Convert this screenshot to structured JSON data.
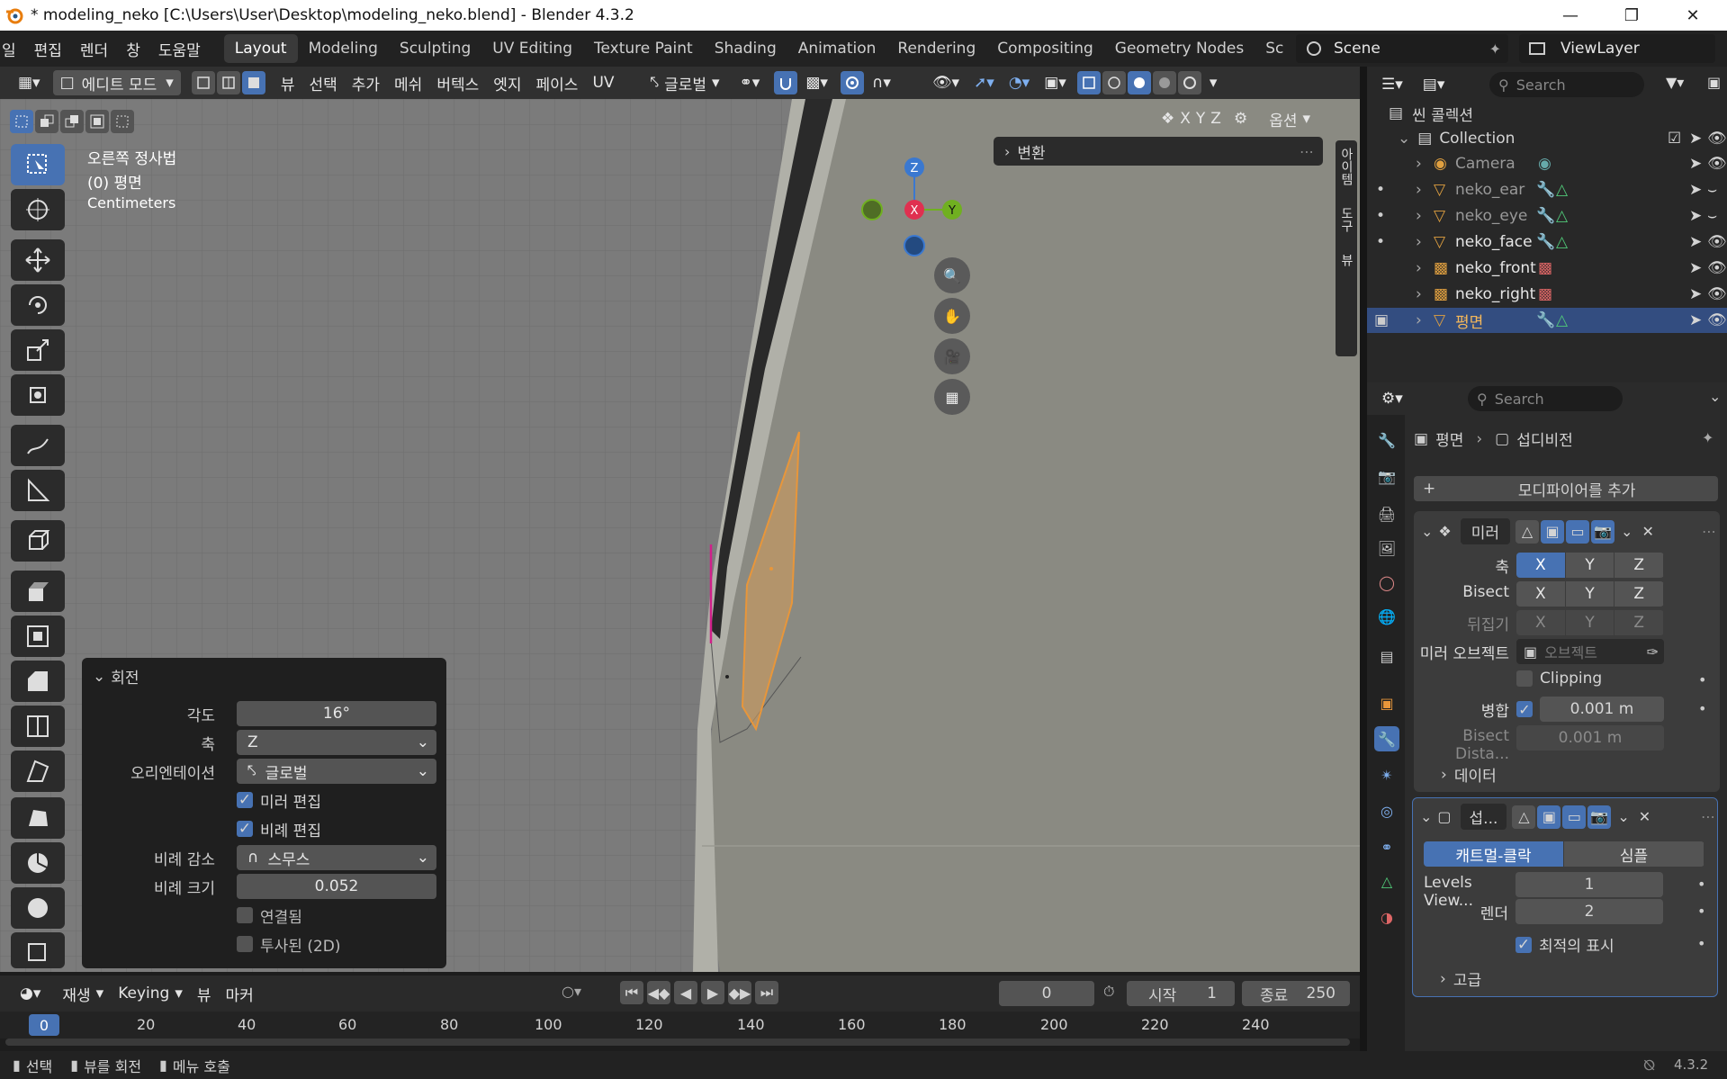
{
  "window": {
    "title": "* modeling_neko [C:\\Users\\User\\Desktop\\modeling_neko.blend] - Blender 4.3.2"
  },
  "menubar": {
    "file": "일",
    "edit": "편집",
    "render": "렌더",
    "window": "창",
    "help": "도움말"
  },
  "workspaces": [
    "Layout",
    "Modeling",
    "Sculpting",
    "UV Editing",
    "Texture Paint",
    "Shading",
    "Animation",
    "Rendering",
    "Compositing",
    "Geometry Nodes",
    "Sc"
  ],
  "scene": {
    "name": "Scene",
    "view_layer": "ViewLayer"
  },
  "viewport_header": {
    "mode": "에디트 모드",
    "view": "뷰",
    "select": "선택",
    "add": "추가",
    "mesh": "메쉬",
    "vertex": "버텍스",
    "edge": "엣지",
    "face": "페이스",
    "uv": "UV",
    "orientation": "글로벌",
    "options": "옵션",
    "x": "X",
    "y": "Y",
    "z": "Z"
  },
  "viewport": {
    "view_name": "오른쪽 정사법",
    "object_info": "(0) 평면",
    "units": "Centimeters",
    "transform_panel": "변환",
    "gizmo": {
      "x": "X",
      "y": "Y",
      "z": "Z"
    }
  },
  "side_tabs": [
    "아이템",
    "도구",
    "뷰"
  ],
  "operator_panel": {
    "title": "회전",
    "angle_label": "각도",
    "angle": "16°",
    "axis_label": "축",
    "axis": "Z",
    "orient_label": "오리엔테이션",
    "orient": "글로벌",
    "mirror_edit": "미러 편집",
    "mirror_checked": true,
    "prop_edit": "비례 편집",
    "prop_checked": true,
    "falloff_label": "비례 감소",
    "falloff": "스무스",
    "size_label": "비례 크기",
    "size": "0.052",
    "connected": "연결됨",
    "projected": "투사된 (2D)"
  },
  "timeline": {
    "playback": "재생",
    "keying": "Keying",
    "view": "뷰",
    "marker": "마커",
    "current_frame": "0",
    "start_label": "시작",
    "start": "1",
    "end_label": "종료",
    "end": "250",
    "ticks": [
      "0",
      "20",
      "40",
      "60",
      "80",
      "100",
      "120",
      "140",
      "160",
      "180",
      "200",
      "220",
      "240"
    ]
  },
  "status": {
    "select": "선택",
    "rotate_view": "뷰를 회전",
    "menu": "메뉴 호출",
    "version": "4.3.2"
  },
  "outliner": {
    "search_placeholder": "Search",
    "root": "씬 콜렉션",
    "collection": "Collection",
    "items": [
      {
        "name": "Camera",
        "color": "#e0a040"
      },
      {
        "name": "neko_ear",
        "color": "#e0a040"
      },
      {
        "name": "neko_eye",
        "color": "#e0a040"
      },
      {
        "name": "neko_face",
        "color": "#e0a040"
      },
      {
        "name": "neko_front",
        "color": "#e0a040"
      },
      {
        "name": "neko_right",
        "color": "#e0a040"
      },
      {
        "name": "평면",
        "color": "#e0a040"
      }
    ]
  },
  "properties": {
    "search_placeholder": "Search",
    "breadcrumb_object": "평면",
    "breadcrumb_modifier": "섭디비전",
    "add_modifier": "모디파이어를 추가",
    "mirror": {
      "name": "미러",
      "axis_label": "축",
      "bisect_label": "Bisect",
      "flip_label": "뒤집기",
      "mirror_obj_label": "미러 오브젝트",
      "mirror_obj_placeholder": "오브젝트",
      "clipping": "Clipping",
      "merge_label": "병합",
      "merge_value": "0.001 m",
      "bisect_dist_label": "Bisect Dista...",
      "bisect_dist_value": "0.001 m",
      "data": "데이터"
    },
    "subsurf": {
      "name": "섭...",
      "catmull": "캐트멀-클락",
      "simple": "심플",
      "levels_label": "Levels View...",
      "levels": "1",
      "render_label": "렌더",
      "render": "2",
      "optimal": "최적의 표시",
      "advanced": "고급"
    }
  },
  "colors": {
    "accent": "#4772b3",
    "selection": "#e8963a",
    "x_axis": "#e03050",
    "y_axis": "#70b020",
    "z_axis": "#3a78d0"
  }
}
